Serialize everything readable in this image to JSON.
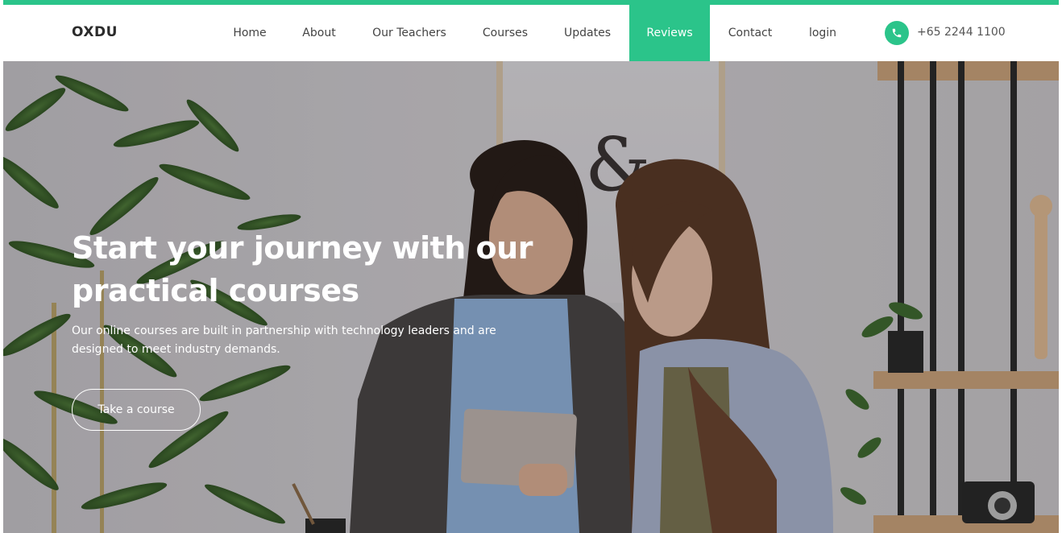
{
  "brand": {
    "logo": "OXDU",
    "accent_color": "#2bc48a"
  },
  "nav": {
    "items": [
      {
        "label": "Home",
        "active": false
      },
      {
        "label": "About",
        "active": false
      },
      {
        "label": "Our Teachers",
        "active": false
      },
      {
        "label": "Courses",
        "active": false
      },
      {
        "label": "Updates",
        "active": false
      },
      {
        "label": "Reviews",
        "active": true
      },
      {
        "label": "Contact",
        "active": false
      },
      {
        "label": "login",
        "active": false
      }
    ],
    "phone": {
      "icon": "phone-icon",
      "number": "+65 2244 1100"
    }
  },
  "hero": {
    "title": "Start your journey with our practical courses",
    "subtitle": "Our online courses are built in partnership with technology leaders and are designed to meet industry demands.",
    "cta_label": "Take a course",
    "background_image": "two-women-looking-at-tablet"
  }
}
